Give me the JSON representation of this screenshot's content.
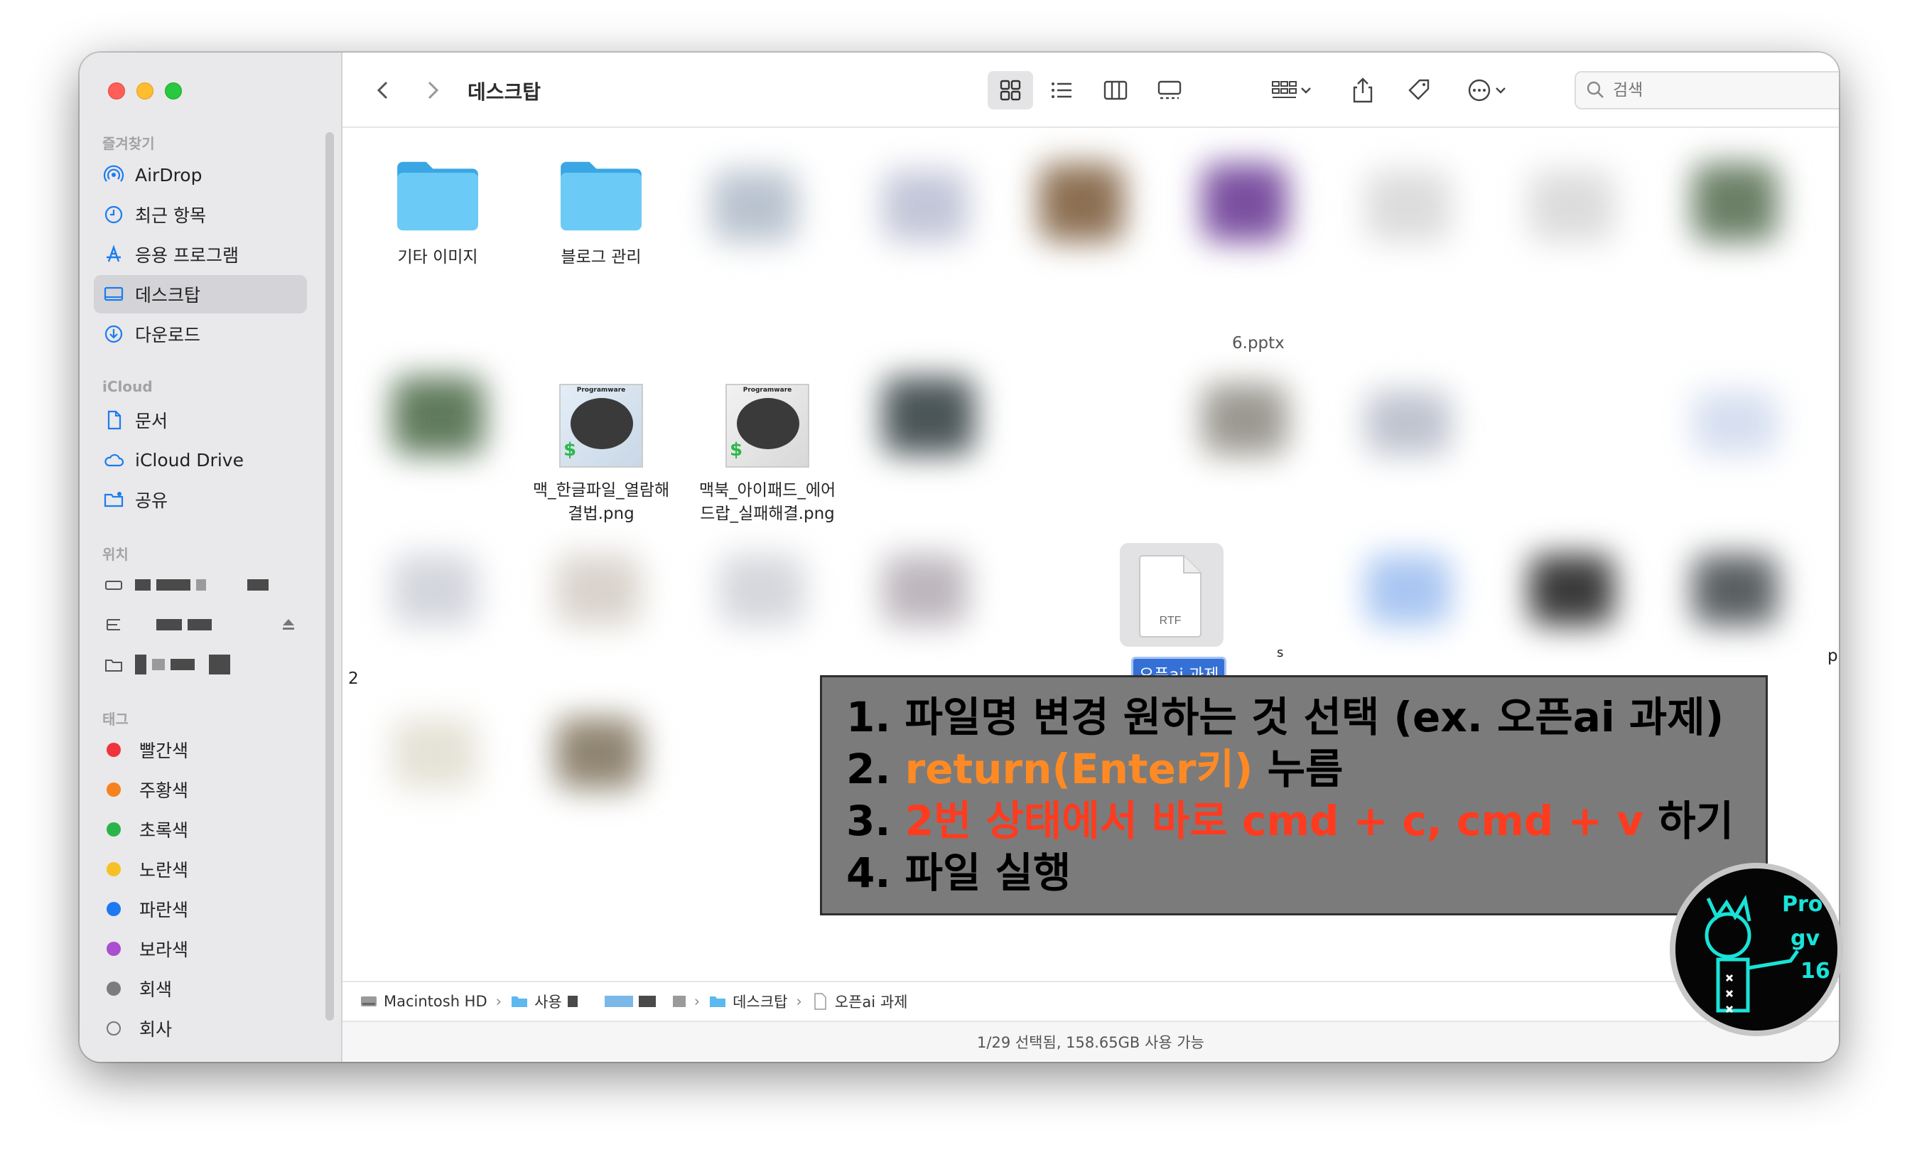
{
  "window": {
    "title": "데스크탑",
    "search_placeholder": "검색"
  },
  "sidebar": {
    "favorites_header": "즐겨찾기",
    "favorites": [
      {
        "label": "AirDrop",
        "icon": "airdrop-icon"
      },
      {
        "label": "최근 항목",
        "icon": "clock-icon"
      },
      {
        "label": "응용 프로그램",
        "icon": "applications-icon"
      },
      {
        "label": "데스크탑",
        "icon": "desktop-icon",
        "active": true
      },
      {
        "label": "다운로드",
        "icon": "download-icon"
      }
    ],
    "icloud_header": "iCloud",
    "icloud": [
      {
        "label": "문서",
        "icon": "document-icon"
      },
      {
        "label": "iCloud Drive",
        "icon": "cloud-icon"
      },
      {
        "label": "공유",
        "icon": "shared-folder-icon"
      }
    ],
    "locations_header": "위치",
    "tags_header": "태그",
    "tags": [
      {
        "label": "빨간색",
        "color": "#f0343b"
      },
      {
        "label": "주황색",
        "color": "#f6821f"
      },
      {
        "label": "초록색",
        "color": "#2ab44a"
      },
      {
        "label": "노란색",
        "color": "#f5c125"
      },
      {
        "label": "파란색",
        "color": "#1e78f0"
      },
      {
        "label": "보라색",
        "color": "#a94fd0"
      },
      {
        "label": "회색",
        "color": "#7c7c80"
      },
      {
        "label": "회사",
        "color": "hollow"
      }
    ]
  },
  "files": {
    "folder1": "기타 이미지",
    "folder2": "블로그 관리",
    "png1_line1": "맥_한글파일_열람해",
    "png1_line2": "결법.png",
    "png2_line1": "맥북_아이패드_에어",
    "png2_line2": "드랍_실패해결.png",
    "rtf_badge": "RTF",
    "rtf_name": "오픈ai 과제",
    "partial_pptx": "6.pptx",
    "stray_2": "2",
    "stray_p": "p",
    "stray_s": "s",
    "thumb_brand": "Programware"
  },
  "annotation": {
    "line1": "1. 파일명 변경 원하는 것 선택 (ex. 오픈ai 과제)",
    "line2_num": "2. ",
    "line2_highlight": "return(Enter키)",
    "line2_rest": " 누름",
    "line3_num": "3. ",
    "line3_highlight": "2번 상태에서 바로 cmd + c, cmd + v",
    "line3_rest": " 하기",
    "line4": "4. 파일 실행"
  },
  "pathbar": {
    "seg1": "Macintosh HD",
    "seg2": "사용",
    "seg3": "데스크탑",
    "seg4": "오픈ai 과제"
  },
  "status": {
    "text": "1/29 선택됨, 158.65GB 사용 가능"
  },
  "logo": {
    "line1": "Pro",
    "line2": "gv",
    "line3": "16"
  },
  "colors": {
    "accent_blue": "#3470d6",
    "folder_blue": "#5cc1f3",
    "annotation_bg": "#7b7b7b",
    "orange_highlight": "#ff8a23",
    "red_highlight": "#ff3b1f"
  }
}
